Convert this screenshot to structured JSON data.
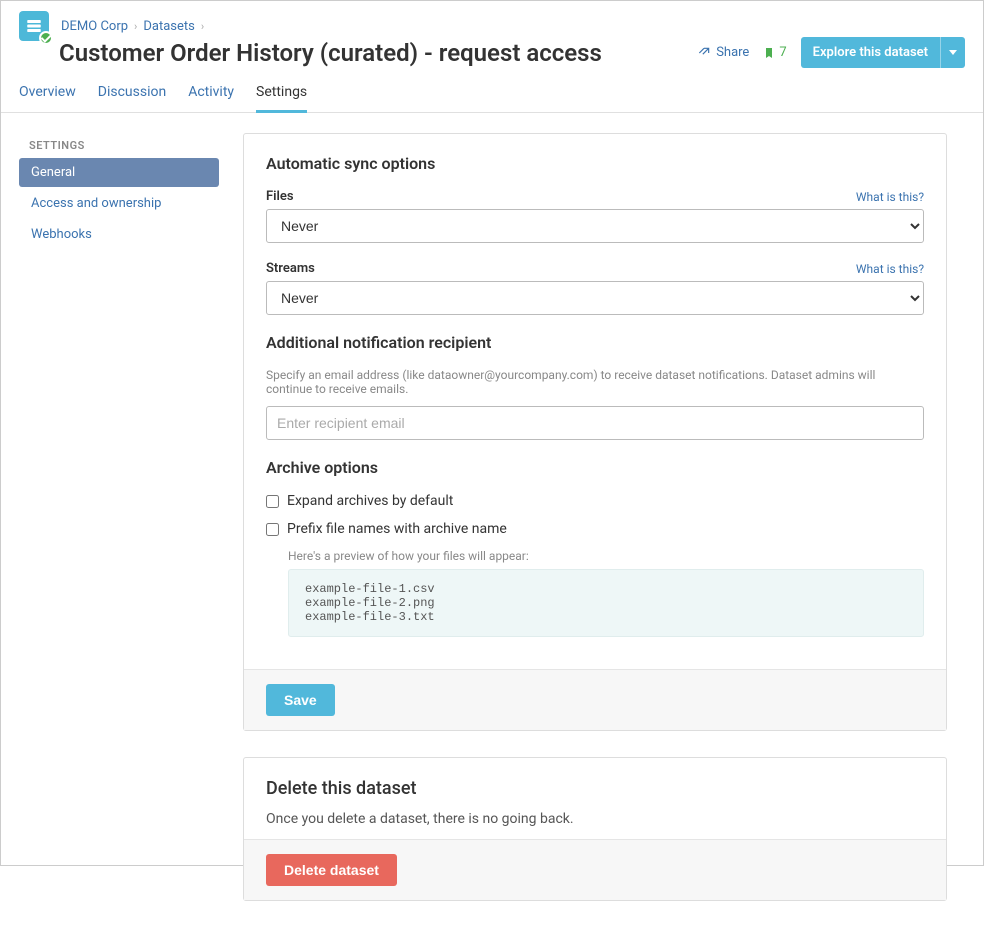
{
  "breadcrumb": {
    "org": "DEMO Corp",
    "section": "Datasets"
  },
  "page_title": "Customer Order History (curated) - request access",
  "header": {
    "share_label": "Share",
    "bookmark_count": "7",
    "explore_label": "Explore this dataset"
  },
  "tabs": {
    "overview": "Overview",
    "discussion": "Discussion",
    "activity": "Activity",
    "settings": "Settings"
  },
  "sidebar": {
    "heading": "SETTINGS",
    "items": {
      "general": "General",
      "access": "Access and ownership",
      "webhooks": "Webhooks"
    }
  },
  "sync": {
    "section_title": "Automatic sync options",
    "files_label": "Files",
    "files_help": "What is this?",
    "files_value": "Never",
    "streams_label": "Streams",
    "streams_help": "What is this?",
    "streams_value": "Never"
  },
  "notify": {
    "section_title": "Additional notification recipient",
    "subtext": "Specify an email address (like dataowner@yourcompany.com) to receive dataset notifications. Dataset admins will continue to receive emails.",
    "placeholder": "Enter recipient email"
  },
  "archive": {
    "section_title": "Archive options",
    "expand_label": "Expand archives by default",
    "prefix_label": "Prefix file names with archive name",
    "preview_label": "Here's a preview of how your files will appear:",
    "preview_text": "example-file-1.csv\nexample-file-2.png\nexample-file-3.txt"
  },
  "save_button": "Save",
  "delete": {
    "title": "Delete this dataset",
    "warning": "Once you delete a dataset, there is no going back.",
    "button": "Delete dataset"
  }
}
